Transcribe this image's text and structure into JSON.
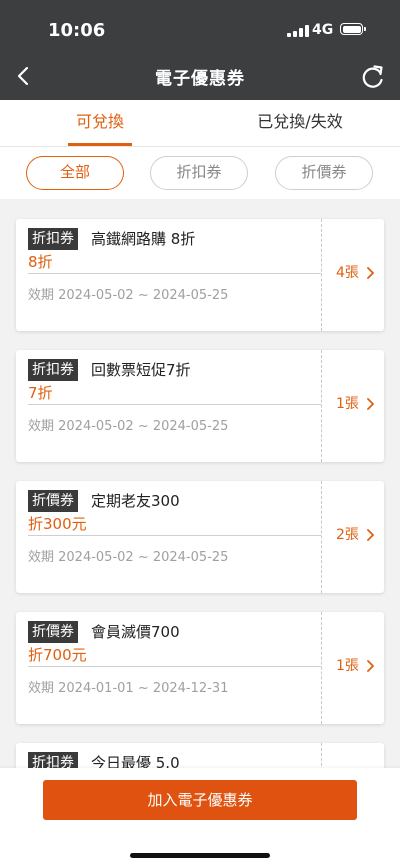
{
  "status_bar": {
    "time": "10:06",
    "network": "4G"
  },
  "header": {
    "title": "電子優惠券"
  },
  "tabs": [
    {
      "label": "可兌換",
      "active": true
    },
    {
      "label": "已兌換/失效",
      "active": false
    }
  ],
  "filters": [
    {
      "label": "全部",
      "active": true
    },
    {
      "label": "折扣券",
      "active": false
    },
    {
      "label": "折價券",
      "active": false
    }
  ],
  "coupons": [
    {
      "type": "折扣券",
      "name": "高鐵網路購 8折",
      "discount": "8折",
      "validity": "效期 2024-05-02 ~ 2024-05-25",
      "count": "4張"
    },
    {
      "type": "折扣券",
      "name": "回數票短促7折",
      "discount": "7折",
      "validity": "效期 2024-05-02 ~ 2024-05-25",
      "count": "1張"
    },
    {
      "type": "折價券",
      "name": "定期老友300",
      "discount": "折300元",
      "validity": "效期 2024-05-02 ~ 2024-05-25",
      "count": "2張"
    },
    {
      "type": "折價券",
      "name": "會員滅價700",
      "discount": "折700元",
      "validity": "效期 2024-01-01 ~ 2024-12-31",
      "count": "1張"
    },
    {
      "type": "折扣券",
      "name": "今日最優 5.0",
      "discount": "",
      "validity": "",
      "count": ""
    }
  ],
  "bottom": {
    "add_button": "加入電子優惠券"
  },
  "colors": {
    "accent": "#e06010",
    "header_bg": "#3c3e40",
    "button": "#e0520f"
  },
  "icons": {
    "back": "chevron-left-icon",
    "refresh": "refresh-icon",
    "count_arrow": "chevron-right-icon"
  }
}
